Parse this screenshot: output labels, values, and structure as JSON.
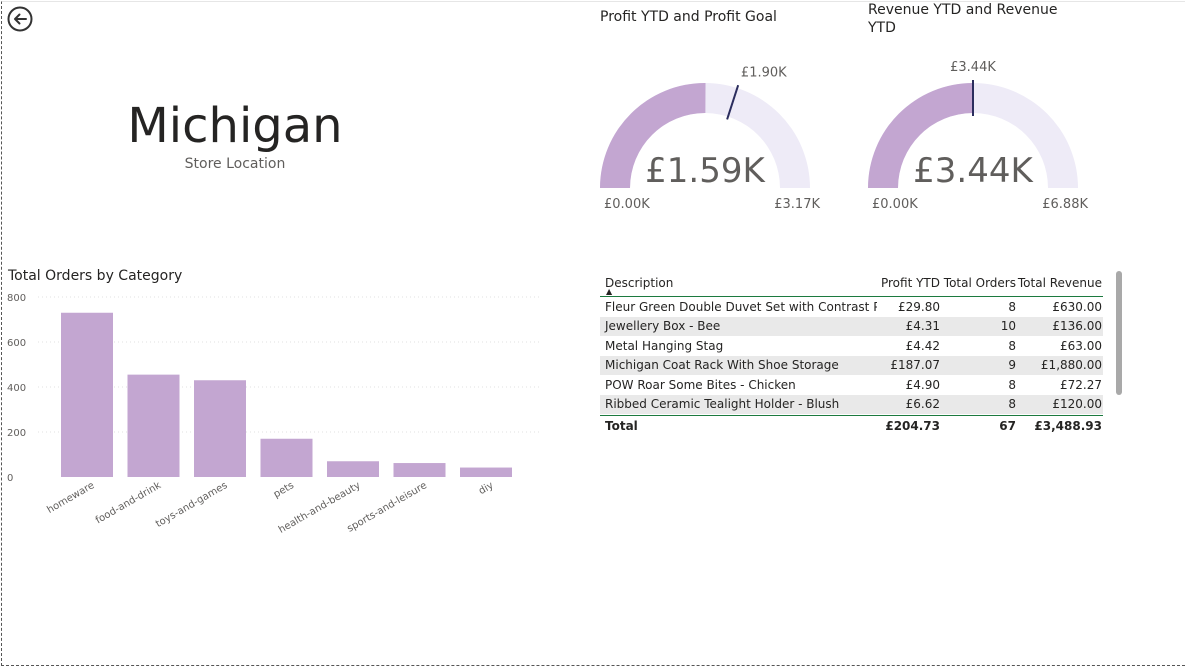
{
  "store": {
    "name": "Michigan",
    "subtitle": "Store Location"
  },
  "gauges": [
    {
      "title": "Profit YTD and Profit Goal",
      "value_label": "£1.59K",
      "min_label": "£0.00K",
      "max_label": "£3.17K",
      "target_label": "£1.90K",
      "value": 1.59,
      "min": 0,
      "max": 3.17,
      "target": 1.9
    },
    {
      "title": "Revenue YTD and Revenue YTD",
      "value_label": "£3.44K",
      "min_label": "£0.00K",
      "max_label": "£6.88K",
      "target_label": "£3.44K",
      "value": 3.44,
      "min": 0,
      "max": 6.88,
      "target": 3.44
    }
  ],
  "colors": {
    "fill": "#c3a6d1",
    "track": "#eeebf7",
    "target": "#2b2d5e",
    "rule": "#1c7a3f",
    "alt_row": "#e9e9e9"
  },
  "table": {
    "columns": [
      "Description",
      "Profit YTD",
      "Total Orders",
      "Total Revenue"
    ],
    "rows": [
      [
        "Fleur Green Double Duvet Set with Contrast Pipe",
        "£29.80",
        "8",
        "£630.00"
      ],
      [
        "Jewellery Box - Bee",
        "£4.31",
        "10",
        "£136.00"
      ],
      [
        "Metal Hanging Stag",
        "£4.42",
        "8",
        "£63.00"
      ],
      [
        "Michigan Coat Rack With Shoe Storage",
        "£187.07",
        "9",
        "£1,880.00"
      ],
      [
        "POW Roar Some Bites - Chicken",
        "£4.90",
        "8",
        "£72.27"
      ],
      [
        "Ribbed Ceramic Tealight Holder - Blush",
        "£6.62",
        "8",
        "£120.00"
      ]
    ],
    "total": [
      "Total",
      "£204.73",
      "67",
      "£3,488.93"
    ]
  },
  "chart_data": {
    "type": "bar",
    "title": "Total Orders by Category",
    "categories": [
      "homeware",
      "food-and-drink",
      "toys-and-games",
      "pets",
      "health-and-beauty",
      "sports-and-leisure",
      "diy"
    ],
    "values": [
      730,
      455,
      430,
      170,
      70,
      62,
      42
    ],
    "yticks": [
      "800",
      "600",
      "400",
      "200",
      "0"
    ],
    "ylim": [
      0,
      800
    ],
    "grid": true,
    "xlabel": "",
    "ylabel": ""
  },
  "icons": {
    "back": "back-arrow-icon"
  }
}
